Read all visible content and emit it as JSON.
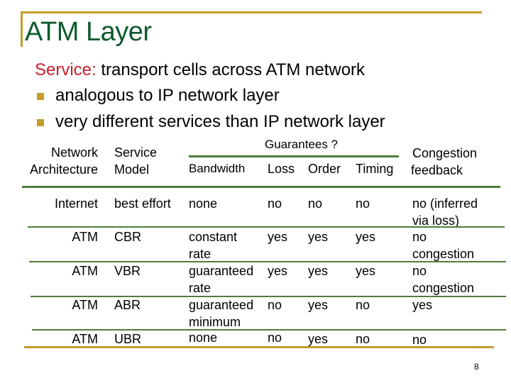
{
  "slide": {
    "title": "ATM Layer",
    "service_label": "Service:",
    "service_text": " transport cells across ATM network",
    "bullets": [
      "analogous to IP network layer",
      "very different services than IP network layer"
    ],
    "page_number": "8"
  },
  "colors": {
    "title": "#0e5a2e",
    "accent_gold": "#c59c2a",
    "service_keyword": "#c8202a",
    "table_rule": "#4e7d3c"
  },
  "table": {
    "headers": {
      "network_architecture": [
        "Network",
        "Architecture"
      ],
      "service_model": [
        "Service",
        "Model"
      ],
      "guarantees_group": "Guarantees ?",
      "bandwidth": "Bandwidth",
      "loss": "Loss",
      "order": "Order",
      "timing": "Timing",
      "congestion_feedback": [
        "Congestion",
        "feedback"
      ]
    },
    "rows": [
      {
        "arch": "Internet",
        "model": "best effort",
        "bandwidth": [
          "none"
        ],
        "loss": "no",
        "order": "no",
        "timing": "no",
        "congestion": [
          "no (inferred",
          "via loss)"
        ]
      },
      {
        "arch": "ATM",
        "model": "CBR",
        "bandwidth": [
          "constant",
          "rate"
        ],
        "loss": "yes",
        "order": "yes",
        "timing": "yes",
        "congestion": [
          "no",
          "congestion"
        ]
      },
      {
        "arch": "ATM",
        "model": "VBR",
        "bandwidth": [
          "guaranteed",
          "rate"
        ],
        "loss": "yes",
        "order": "yes",
        "timing": "yes",
        "congestion": [
          "no",
          "congestion"
        ]
      },
      {
        "arch": "ATM",
        "model": "ABR",
        "bandwidth": [
          "guaranteed",
          "minimum"
        ],
        "loss": "no",
        "order": "yes",
        "timing": "no",
        "congestion": [
          "yes"
        ]
      },
      {
        "arch": "ATM",
        "model": "UBR",
        "bandwidth": [
          "none"
        ],
        "loss": "no",
        "order": "yes",
        "timing": "no",
        "congestion": [
          "no"
        ]
      }
    ]
  }
}
